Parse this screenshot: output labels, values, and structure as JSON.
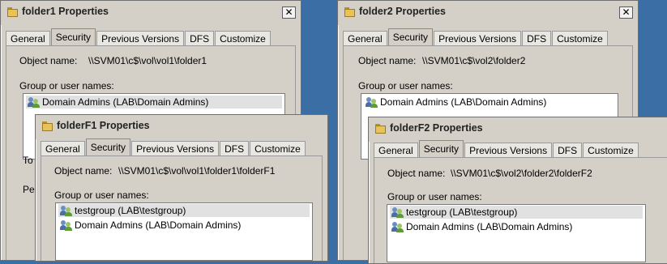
{
  "tabs": [
    "General",
    "Security",
    "Previous Versions",
    "DFS",
    "Customize"
  ],
  "close_glyph": "✕",
  "object_name_label": "Object name:",
  "group_label": "Group or user names:",
  "folder_icon": "folder-icon",
  "user_group_icon": "user-group-icon",
  "dialogs": [
    {
      "title": "folder1 Properties",
      "object_path": "\\\\SVM01\\c$\\vol\\vol1\\folder1",
      "users": [
        "Domain Admins (LAB\\Domain Admins)"
      ],
      "stubs": [
        "To",
        "Pe"
      ]
    },
    {
      "title": "folder2 Properties",
      "object_path": "\\\\SVM01\\c$\\vol2\\folder2",
      "users": [
        "Domain Admins (LAB\\Domain Admins)"
      ],
      "stubs": []
    },
    {
      "title": "folderF1 Properties",
      "object_path": "\\\\SVM01\\c$\\vol\\vol1\\folder1\\folderF1",
      "users": [
        "testgroup (LAB\\testgroup)",
        "Domain Admins (LAB\\Domain Admins)"
      ],
      "stubs": []
    },
    {
      "title": "folderF2 Properties",
      "object_path": "\\\\SVM01\\c$\\vol2\\folder2\\folderF2",
      "users": [
        "testgroup (LAB\\testgroup)",
        "Domain Admins (LAB\\Domain Admins)"
      ],
      "stubs": []
    }
  ]
}
